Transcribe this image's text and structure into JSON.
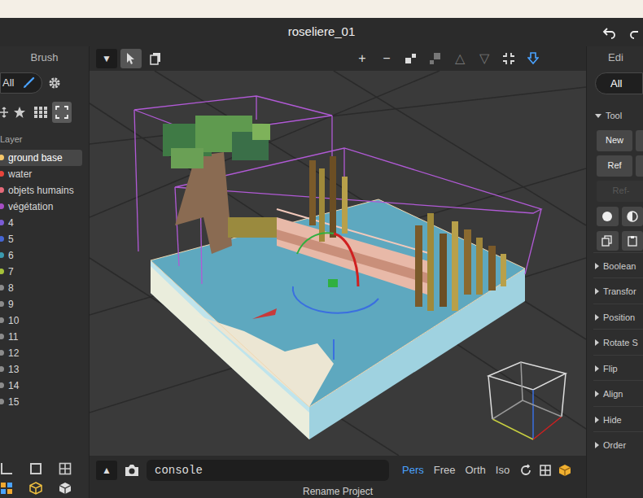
{
  "window": {
    "title": "roseliere_01"
  },
  "brush_panel": {
    "title": "Brush",
    "filter": "All",
    "layer_label": "Layer",
    "layers": [
      {
        "name": "ground base",
        "selected": true,
        "color": "#f5c76a"
      },
      {
        "name": "water",
        "selected": false,
        "color": "#e8453c"
      },
      {
        "name": "objets humains",
        "selected": false,
        "color": "#e66a7a"
      },
      {
        "name": "végétation",
        "selected": false,
        "color": "#a64ec4"
      },
      {
        "name": "4",
        "selected": false,
        "color": "#7b5cd6"
      },
      {
        "name": "5",
        "selected": false,
        "color": "#4566d4"
      },
      {
        "name": "6",
        "selected": false,
        "color": "#3a9bb0"
      },
      {
        "name": "7",
        "selected": false,
        "color": "#a6c23a"
      },
      {
        "name": "8",
        "selected": false,
        "color": "#8c8c8c"
      },
      {
        "name": "9",
        "selected": false,
        "color": "#8c8c8c"
      },
      {
        "name": "10",
        "selected": false,
        "color": "#8c8c8c"
      },
      {
        "name": "11",
        "selected": false,
        "color": "#8c8c8c"
      },
      {
        "name": "12",
        "selected": false,
        "color": "#8c8c8c"
      },
      {
        "name": "13",
        "selected": false,
        "color": "#8c8c8c"
      },
      {
        "name": "14",
        "selected": false,
        "color": "#8c8c8c"
      },
      {
        "name": "15",
        "selected": false,
        "color": "#8c8c8c"
      }
    ]
  },
  "toolbar": {
    "menu": "▼",
    "plus": "+",
    "minus": "−",
    "up": "△",
    "down": "▽"
  },
  "bottom_bar": {
    "expand": "▲",
    "console": "console",
    "view_modes": [
      {
        "label": "Pers",
        "selected": true
      },
      {
        "label": "Free",
        "selected": false
      },
      {
        "label": "Orth",
        "selected": false
      },
      {
        "label": "Iso",
        "selected": false
      }
    ]
  },
  "status_bar": "Rename Project",
  "edit_panel": {
    "title": "Edi",
    "filter": "All",
    "tool": {
      "label": "Tool",
      "expanded": true
    },
    "tool_buttons": [
      "New",
      "Ref"
    ],
    "disabled_button": {
      "label": "Ref-",
      "disabled": true
    },
    "sections": [
      {
        "label": "Boolean",
        "expanded": false
      },
      {
        "label": "Transfor",
        "expanded": false
      },
      {
        "label": "Position",
        "expanded": false
      },
      {
        "label": "Rotate S",
        "expanded": false
      },
      {
        "label": "Flip",
        "expanded": false
      },
      {
        "label": "Align",
        "expanded": false
      },
      {
        "label": "Hide",
        "expanded": false
      },
      {
        "label": "Order",
        "expanded": false
      }
    ]
  }
}
